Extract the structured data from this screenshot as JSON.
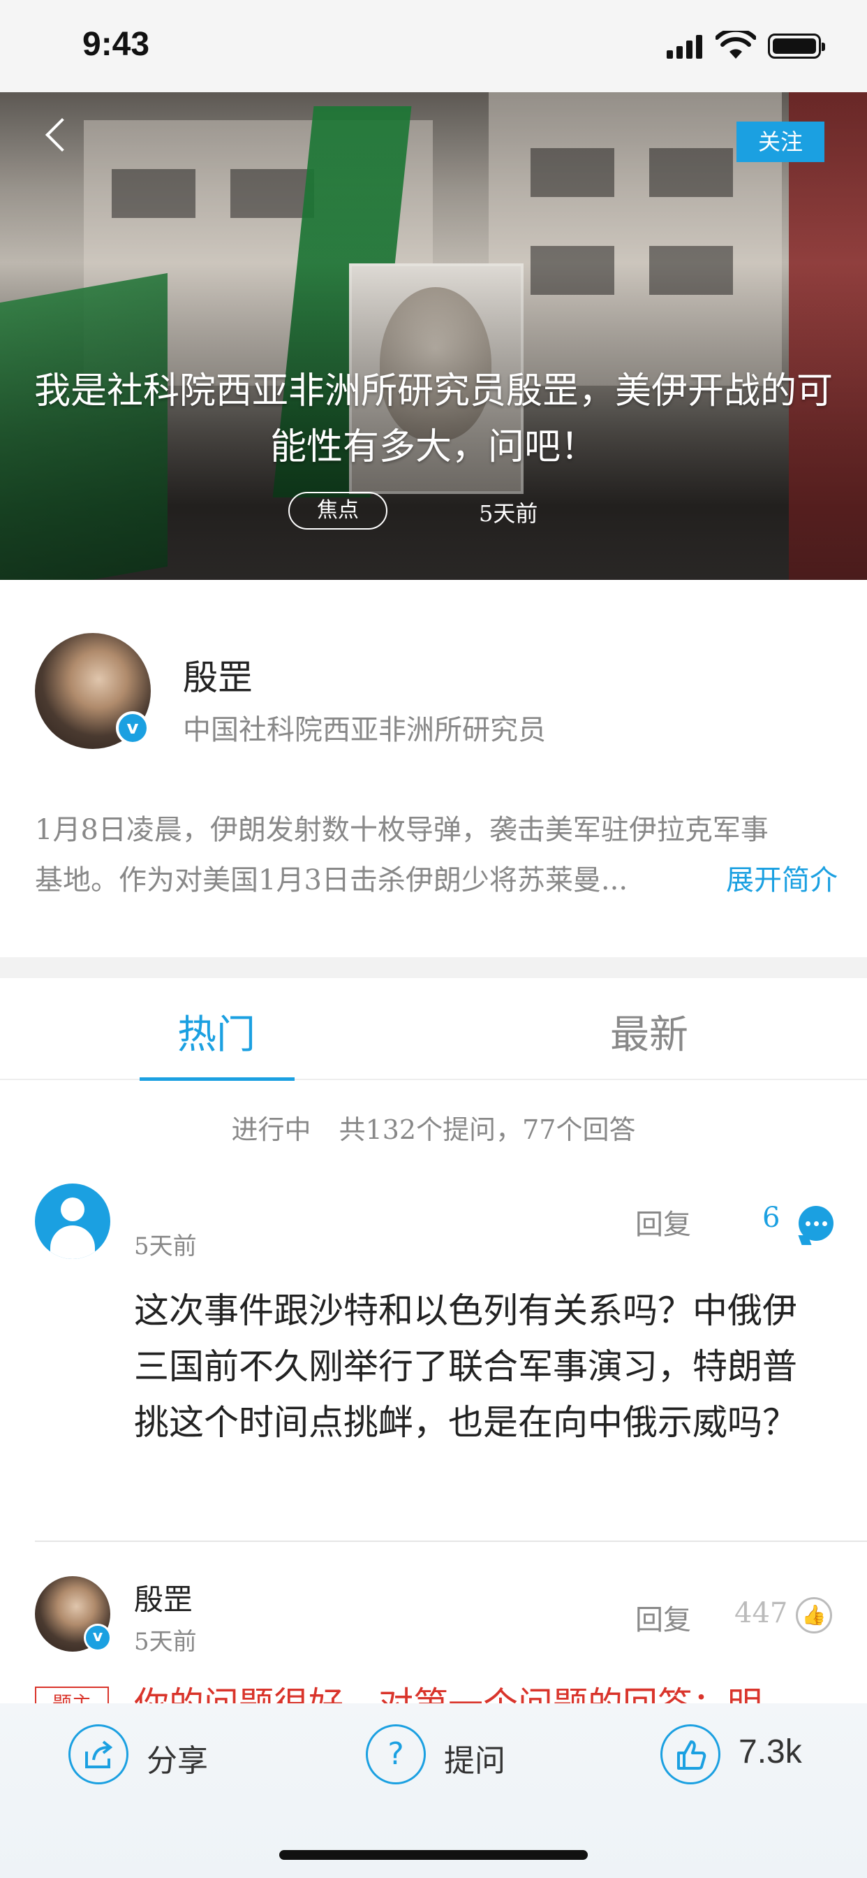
{
  "status_bar": {
    "time": "9:43"
  },
  "hero": {
    "follow_label": "关注",
    "title": "我是社科院西亚非洲所研究员殷罡，美伊开战的可能性有多大，问吧！",
    "tag": "焦点",
    "time": "5天前"
  },
  "author": {
    "name": "殷罡",
    "title": "中国社科院西亚非洲所研究员",
    "badge": "v",
    "intro_line1": "1月8日凌晨，伊朗发射数十枚导弹，袭击美军驻伊拉克军事",
    "intro_line2": "基地。作为对美国1月3日击杀伊朗少将苏莱曼...",
    "expand_label": "展开简介"
  },
  "tabs": {
    "hot": "热门",
    "new": "最新"
  },
  "stats": {
    "status": "进行中",
    "summary": "共132个提问，77个回答"
  },
  "question": {
    "time": "5天前",
    "reply_label": "回复",
    "reply_count": "6",
    "text": "这次事件跟沙特和以色列有关系吗？中俄伊三国前不久刚举行了联合军事演习，特朗普挑这个时间点挑衅，也是在向中俄示威吗？"
  },
  "answer": {
    "name": "殷罡",
    "time": "5天前",
    "badge": "v",
    "reply_label": "回复",
    "like_count": "447",
    "tag": "题主",
    "text": "你的问题很好。对第一个问题的回答：明"
  },
  "bottom_bar": {
    "share_label": "分享",
    "ask_label": "提问",
    "like_count": "7.3k"
  },
  "colors": {
    "accent": "#1ba0e1",
    "answer_red": "#d9342b",
    "muted": "#888888"
  }
}
